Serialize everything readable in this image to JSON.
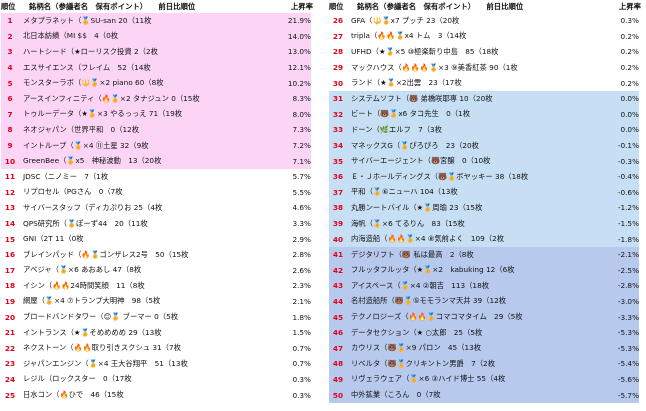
{
  "left": {
    "headers": {
      "rank": "順位",
      "name": "銘柄名（参議者名　保有ポイント）　　前日比順位",
      "rate": "上昇率"
    },
    "rows": [
      {
        "rank": "1",
        "name": "メタプラネット（🏅SU-san 20（11枚",
        "rate": "21.9%"
      },
      {
        "rank": "2",
        "name": "北日本紡績（MI $$　4（0枚",
        "rate": "14.0%"
      },
      {
        "rank": "3",
        "name": "ハートシード（★ローリスク投資 2（2枚",
        "rate": "13.0%"
      },
      {
        "rank": "4",
        "name": "エスサイエンス（フレイム　52（14枚",
        "rate": "12.1%"
      },
      {
        "rank": "5",
        "name": "モンスターラボ（🔱🏅×2 piano 60（8枚",
        "rate": "10.2%"
      },
      {
        "rank": "6",
        "name": "アースインフィニティ（🔥🏅×2 タナジュン 0（15枚",
        "rate": "8.3%"
      },
      {
        "rank": "7",
        "name": "トゥルーデータ（★🏅×3 やるっっえ 71（19枚",
        "rate": "8.0%"
      },
      {
        "rank": "8",
        "name": "ネオジャパン（世界平和　0（12枚",
        "rate": "7.3%"
      },
      {
        "rank": "9",
        "name": "イントループ（🏅×4 ⑪土星 32（9枚",
        "rate": "7.2%"
      },
      {
        "rank": "10",
        "name": "GreenBee（🏅x5　神秘波動　13（20枚",
        "rate": "7.1%"
      },
      {
        "rank": "11",
        "name": "JDSC（ニノミー　7（1枚",
        "rate": "5.7%"
      },
      {
        "rank": "12",
        "name": "リプロセル（PGさん　0（7枚",
        "rate": "5.5%"
      },
      {
        "rank": "13",
        "name": "サイバースタッフ（ディカぷりお 25（4枚",
        "rate": "4.6%"
      },
      {
        "rank": "14",
        "name": "QPS研究所（🏅ぽーず44　20（11枚",
        "rate": "3.3%"
      },
      {
        "rank": "15",
        "name": "GNI（2T 11（0枚",
        "rate": "2.9%"
      },
      {
        "rank": "16",
        "name": "ブレインパッド（🔥🏅ゴンザレス2号　50（15枚",
        "rate": "2.8%"
      },
      {
        "rank": "17",
        "name": "アベジャ（🏅×6 あおあし 47（8枚",
        "rate": "2.6%"
      },
      {
        "rank": "18",
        "name": "イシン（🔥🔥24時間笑顔　11（8枚",
        "rate": "2.3%"
      },
      {
        "rank": "19",
        "name": "網屋（🏅×4 ⑦トランプ大明神　98（5枚",
        "rate": "2.1%"
      },
      {
        "rank": "20",
        "name": "ブロードバンドタワー（😊🏅 ブーマー 0（5枚",
        "rate": "1.8%"
      },
      {
        "rank": "21",
        "name": "イントランス（★🏅そめめめめ 29（13枚",
        "rate": "1.5%"
      },
      {
        "rank": "22",
        "name": "ネクストーン（🔥🔥取り引きスクシュ 31（7枚",
        "rate": "0.7%"
      },
      {
        "rank": "23",
        "name": "ジャパンエンジン（🏅×4 王大谷翔平　51（13枚",
        "rate": "0.7%"
      },
      {
        "rank": "24",
        "name": "レジル（ロックスター　0（17枚",
        "rate": "0.3%"
      },
      {
        "rank": "25",
        "name": "日水コン（🔥ひで　46（15枚",
        "rate": "0.3%"
      }
    ]
  },
  "right": {
    "headers": {
      "rank": "順位",
      "name": "銘柄名（参議者名　保有ポイント）　　前日比順位",
      "rate": "上昇率"
    },
    "rows": [
      {
        "rank": "26",
        "name": "GFA（🔱🏅x7 プッチ 23（20枚",
        "rate": "0.3%"
      },
      {
        "rank": "27",
        "name": "tripla（🔥🔥🏅x4 トム　3（14枚",
        "rate": "0.2%"
      },
      {
        "rank": "28",
        "name": "UFHD（★🏅×5 ⑩極楽斬り中島　85（18枚",
        "rate": "0.2%"
      },
      {
        "rank": "29",
        "name": "マックハウス（🔥🔥🔥🏅×3 ⑨美香紅茶 90（1枚",
        "rate": "0.2%"
      },
      {
        "rank": "30",
        "name": "ランド（★🏅×2出雲　23（17枚",
        "rate": "0.2%"
      },
      {
        "rank": "31",
        "name": "システムソフト（🐻 弟橋咲耶専 10（20枚",
        "rate": "0.0%"
      },
      {
        "rank": "32",
        "name": "ビート（🐻🏅x6 タコ先生　0（1枚",
        "rate": "0.0%"
      },
      {
        "rank": "33",
        "name": "ドーン（🌿エルフ　7（3枚",
        "rate": "0.0%"
      },
      {
        "rank": "34",
        "name": "マネックスG（🏅ぴろぴろ　23（20枚",
        "rate": "-0.1%"
      },
      {
        "rank": "35",
        "name": "サイバーエージェント（🐻宮醸　0（10枚",
        "rate": "-0.3%"
      },
      {
        "rank": "36",
        "name": "Ｅ・Ｊホールディングス（🐻🏅ボヤッキー 38（18枚",
        "rate": "-0.4%"
      },
      {
        "rank": "37",
        "name": "平和（🏅⑥ニューハ 104（13枚",
        "rate": "-0.6%"
      },
      {
        "rank": "38",
        "name": "丸勝ンートバイル（★🏅周瑜 23（15枚",
        "rate": "-1.2%"
      },
      {
        "rank": "39",
        "name": "海帆（🏅×6 てるりん　83（15枚",
        "rate": "-1.5%"
      },
      {
        "rank": "40",
        "name": "内海造船（🔥🔥🏅×4 ⑧気前よく　109（2枚",
        "rate": "-1.8%"
      },
      {
        "rank": "41",
        "name": "デジタリフト（🐻 私は最高　2（8枚",
        "rate": "-2.1%"
      },
      {
        "rank": "42",
        "name": "フルッタフルッタ（★🏅×2　kabuking 12（6枚",
        "rate": "-2.5%"
      },
      {
        "rank": "43",
        "name": "アイスペース（🏅×4 ②朝吉　113（18枚",
        "rate": "-2.8%"
      },
      {
        "rank": "44",
        "name": "名村造船所（🐻🏅⑤モモランマ天井 39（12枚",
        "rate": "-3.0%"
      },
      {
        "rank": "45",
        "name": "テクノロジーズ（🔥🔥🏅コマコマタイム　29（5枚",
        "rate": "-3.3%"
      },
      {
        "rank": "46",
        "name": "データセクション（★ ○太郎　25（5枚",
        "rate": "-5.3%"
      },
      {
        "rank": "47",
        "name": "カウリス（🐻🏅×9 パロン　45（13枚",
        "rate": "-5.3%"
      },
      {
        "rank": "48",
        "name": "リベルタ（🐻🏅クリキントン男爵　7（2枚",
        "rate": "-5.4%"
      },
      {
        "rank": "49",
        "name": "リヴェラウェア（🏅×6 ③ハイド博士 55（4枚",
        "rate": "-5.6%"
      },
      {
        "rank": "50",
        "name": "中外鉱業（ころん　0（7枚",
        "rate": "-5.7%"
      }
    ]
  }
}
